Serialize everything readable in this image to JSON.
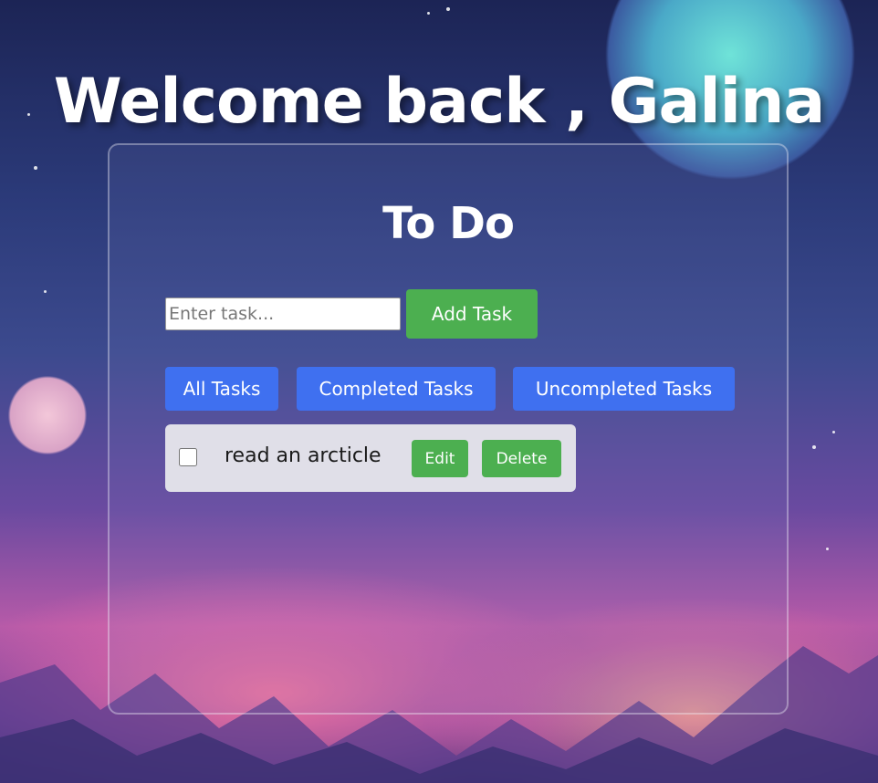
{
  "header": {
    "welcome_text": "Welcome back , Galina"
  },
  "todo": {
    "title": "To Do",
    "input_placeholder": "Enter task...",
    "input_value": "",
    "add_button_label": "Add Task",
    "filters": {
      "all": "All Tasks",
      "completed": "Completed Tasks",
      "uncompleted": "Uncompleted Tasks"
    },
    "tasks": [
      {
        "text": "read an arcticle",
        "completed": false,
        "edit_label": "Edit",
        "delete_label": "Delete"
      }
    ]
  },
  "colors": {
    "action_green": "#4caf50",
    "filter_blue": "#3f70f0",
    "task_row_bg": "#e0dfe8"
  }
}
